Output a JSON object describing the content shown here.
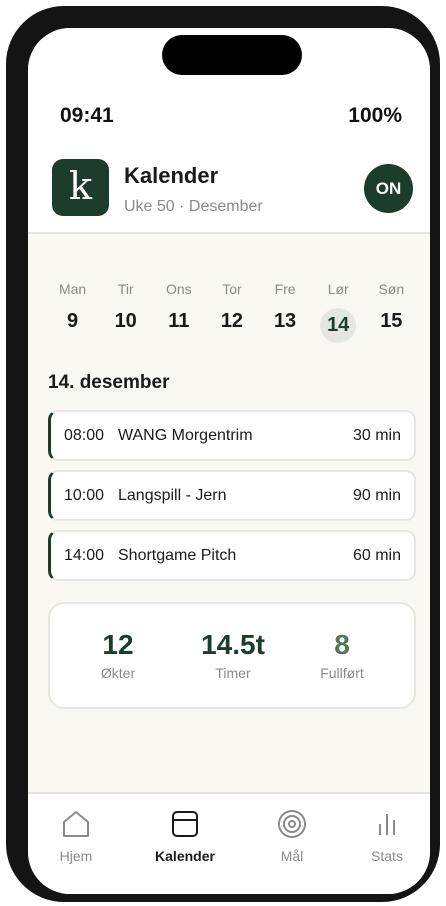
{
  "status": {
    "time": "09:41",
    "battery": "100%"
  },
  "header": {
    "logo_letter": "k",
    "title": "Kalender",
    "subtitle": "Uke 50 · Desember",
    "avatar_initials": "ON"
  },
  "week": {
    "days": [
      {
        "name": "Man",
        "num": "9"
      },
      {
        "name": "Tir",
        "num": "10"
      },
      {
        "name": "Ons",
        "num": "11"
      },
      {
        "name": "Tor",
        "num": "12"
      },
      {
        "name": "Fre",
        "num": "13"
      },
      {
        "name": "Lør",
        "num": "14",
        "selected": true
      },
      {
        "name": "Søn",
        "num": "15"
      }
    ]
  },
  "date_heading": "14. desember",
  "sessions": [
    {
      "time": "08:00",
      "name": "WANG Morgentrim",
      "duration": "30 min"
    },
    {
      "time": "10:00",
      "name": "Langspill - Jern",
      "duration": "90 min"
    },
    {
      "time": "14:00",
      "name": "Shortgame Pitch",
      "duration": "60 min"
    }
  ],
  "stats": [
    {
      "value": "12",
      "label": "Økter"
    },
    {
      "value": "14.5t",
      "label": "Timer"
    },
    {
      "value": "8",
      "label": "Fullført"
    }
  ],
  "nav": {
    "items": [
      {
        "label": "Hjem",
        "icon": "home-icon"
      },
      {
        "label": "Kalender",
        "icon": "calendar-icon",
        "active": true
      },
      {
        "label": "Mål",
        "icon": "target-icon"
      },
      {
        "label": "Stats",
        "icon": "bar-chart-icon"
      }
    ]
  },
  "colors": {
    "brand": "#1c3d2b",
    "accent_green": "#4f7a55",
    "background": "#faf8f3"
  }
}
